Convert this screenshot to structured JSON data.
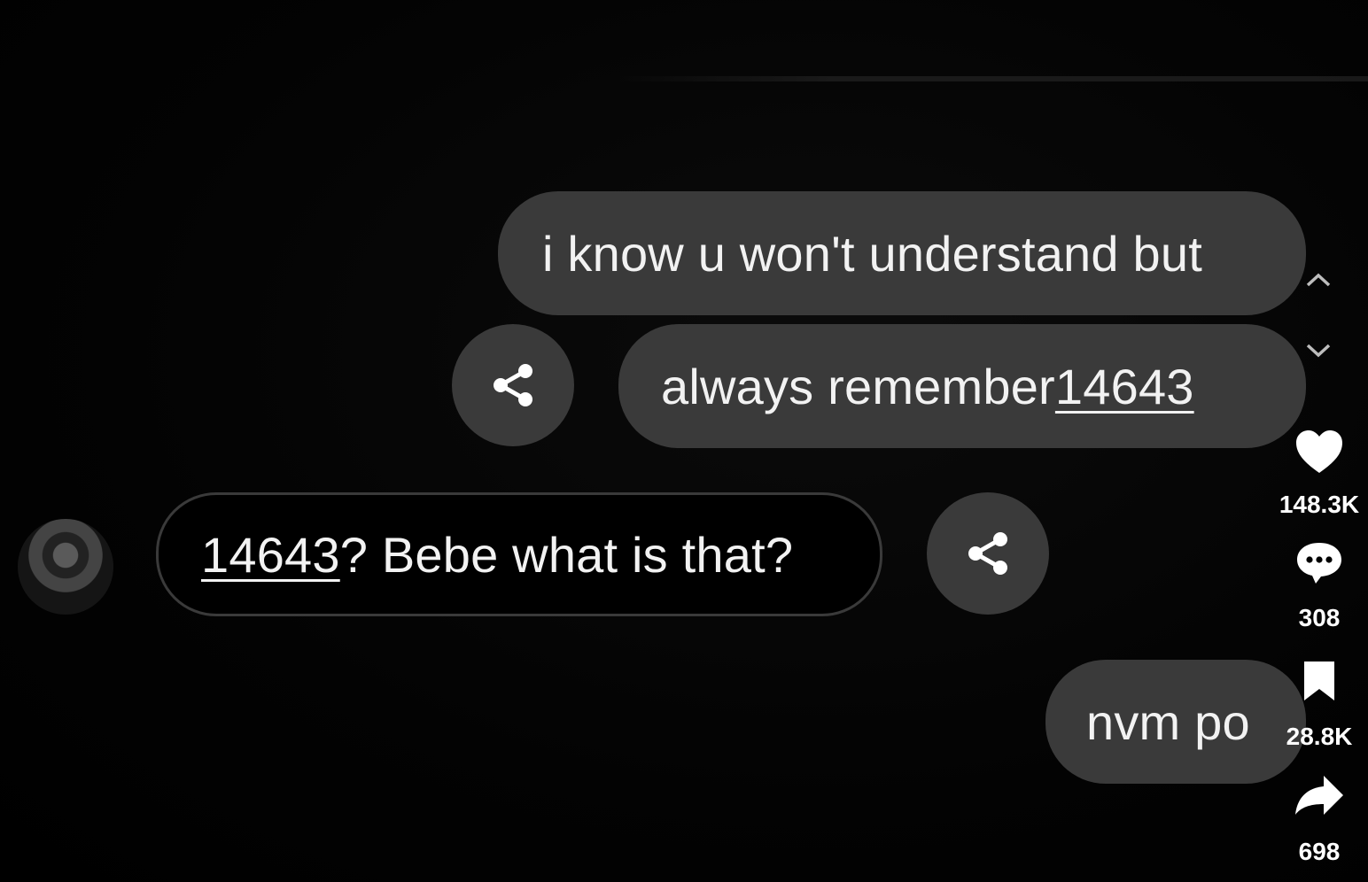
{
  "messages": [
    {
      "text": "i know u won't understand but"
    },
    {
      "text_before": "always remember ",
      "number": "14643"
    },
    {
      "number": "14643",
      "text_after": "? Bebe what is that?"
    },
    {
      "text": "nvm po"
    }
  ],
  "actions": {
    "likes": "148.3K",
    "comments": "308",
    "saves": "28.8K",
    "shares": "698"
  },
  "icons": [
    "share-icon",
    "chevron-up-icon",
    "chevron-down-icon",
    "heart-icon",
    "comment-icon",
    "bookmark-icon",
    "share-arrow-icon"
  ]
}
